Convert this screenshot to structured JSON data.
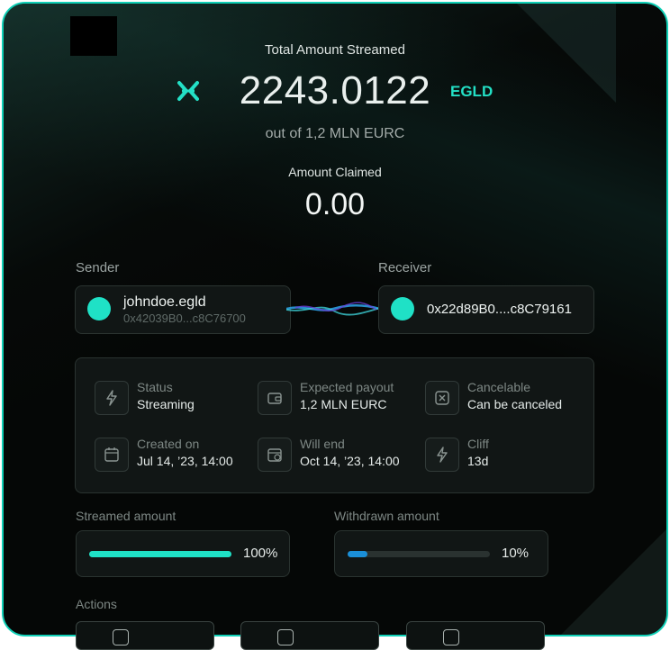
{
  "header": {
    "total_label": "Total Amount Streamed",
    "total_amount": "2243.0122",
    "currency": "EGLD",
    "out_of": "out of 1,2 MLN EURC",
    "claimed_label": "Amount Claimed",
    "claimed_amount": "0.00"
  },
  "parties": {
    "sender_label": "Sender",
    "sender_name": "johndoe.egld",
    "sender_address": "0x42039B0...c8C76700",
    "receiver_label": "Receiver",
    "receiver_address": "0x22d89B0....c8C79161"
  },
  "info": {
    "status_k": "Status",
    "status_v": "Streaming",
    "payout_k": "Expected payout",
    "payout_v": "1,2 MLN EURC",
    "cancel_k": "Cancelable",
    "cancel_v": "Can be canceled",
    "created_k": "Created on",
    "created_v": "Jul 14, ’23, 14:00",
    "end_k": "Will end",
    "end_v": "Oct 14, ’23, 14:00",
    "cliff_k": "Cliff",
    "cliff_v": "13d"
  },
  "progress": {
    "streamed_label": "Streamed amount",
    "streamed_pct": "100%",
    "streamed_value": 1.0,
    "withdrawn_label": "Withdrawn amount",
    "withdrawn_pct": "10%",
    "withdrawn_value": 0.1
  },
  "actions": {
    "label": "Actions"
  },
  "colors": {
    "accent": "#1fe1c6",
    "withdrawn_bar": "#1a8fd8",
    "border": "#0fcfb6"
  }
}
